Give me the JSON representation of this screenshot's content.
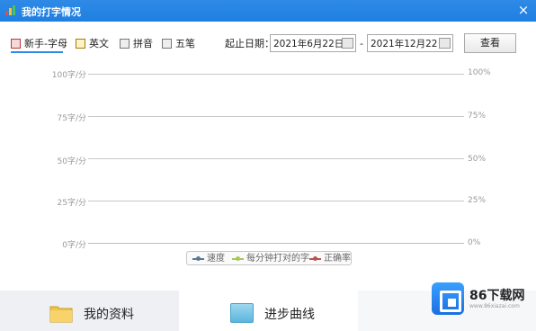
{
  "window": {
    "title": "我的打字情况",
    "close_glyph": "×"
  },
  "tabs": [
    {
      "label": "新手-字母",
      "active": true
    },
    {
      "label": "英文",
      "active": false
    },
    {
      "label": "拼音",
      "active": false
    },
    {
      "label": "五笔",
      "active": false
    }
  ],
  "filter": {
    "date_label": "起止日期：",
    "start_date": "2021年6月22日",
    "separator": "-",
    "end_date": "2021年12月22日",
    "query_label": "查看"
  },
  "chart_data": {
    "type": "line",
    "y_left_ticks": [
      "100字/分",
      "75字/分",
      "50字/分",
      "25字/分",
      "0字/分"
    ],
    "y_right_ticks": [
      "100%",
      "75%",
      "50%",
      "25%",
      "0%"
    ],
    "ylim_left": [
      0,
      100
    ],
    "ylim_right": [
      0,
      100
    ],
    "grid": true,
    "legend_placement": "bottom",
    "series": [
      {
        "name": "速度",
        "color": "#5a7894",
        "values": []
      },
      {
        "name": "每分钟打对的字",
        "color": "#a8c75a",
        "values": []
      },
      {
        "name": "正确率",
        "color": "#b85450",
        "values": []
      }
    ]
  },
  "bottom_nav": [
    {
      "label": "我的资料",
      "active": false
    },
    {
      "label": "进步曲线",
      "active": true
    }
  ],
  "watermark": {
    "brand": "86下载网",
    "sub": "www.86xiazai.com"
  }
}
